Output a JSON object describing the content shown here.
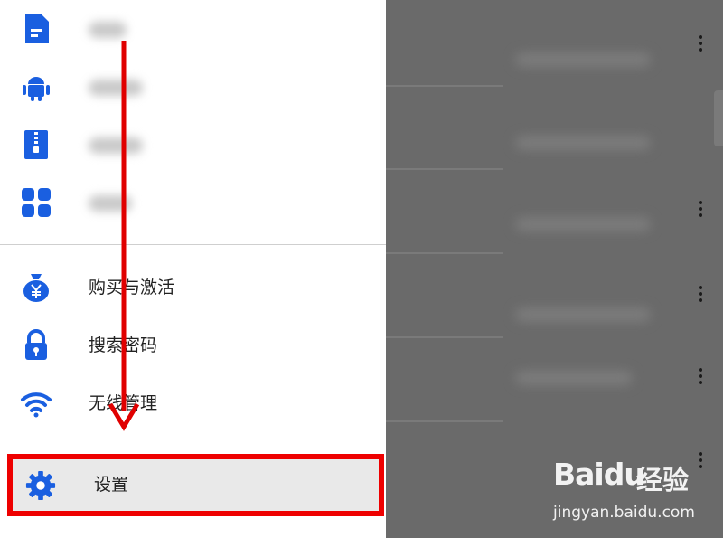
{
  "drawer": {
    "top_items": [
      {
        "icon": "document-icon",
        "label": ""
      },
      {
        "icon": "android-icon",
        "label": ""
      },
      {
        "icon": "zip-archive-icon",
        "label": ""
      },
      {
        "icon": "apps-grid-icon",
        "label": ""
      }
    ],
    "menu_items": [
      {
        "icon": "money-bag-icon",
        "label": "购买与激活"
      },
      {
        "icon": "lock-icon",
        "label": "搜索密码"
      },
      {
        "icon": "wifi-icon",
        "label": "无线管理"
      }
    ],
    "settings": {
      "icon": "gear-icon",
      "label": "设置"
    }
  },
  "colors": {
    "accent": "#1a5fe0",
    "highlight_border": "#ee0000",
    "arrow": "#e00000"
  },
  "watermark": {
    "brand": "Baidu",
    "brand_cn": "经验",
    "url": "jingyan.baidu.com"
  }
}
